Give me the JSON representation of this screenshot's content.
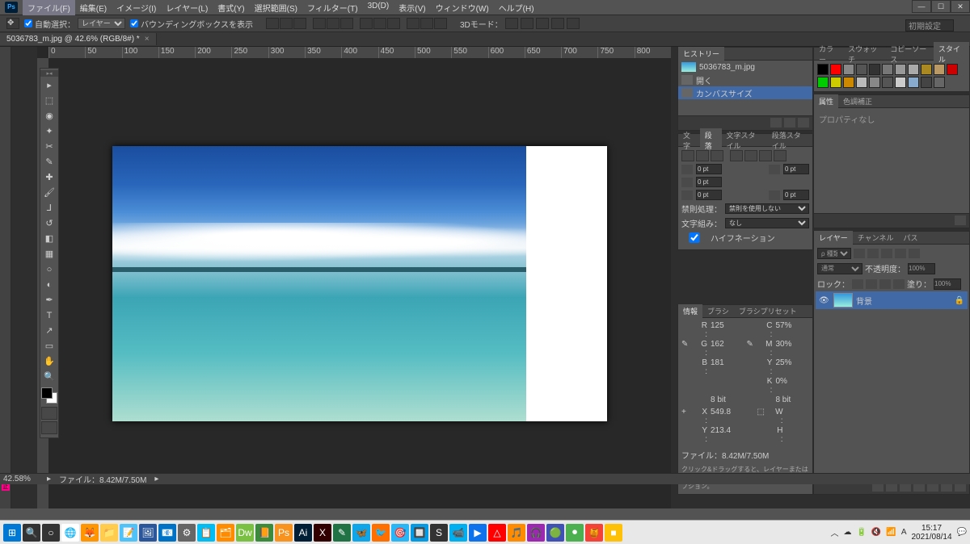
{
  "menu": [
    "ファイル(F)",
    "編集(E)",
    "イメージ(I)",
    "レイヤー(L)",
    "書式(Y)",
    "選択範囲(S)",
    "フィルター(T)",
    "3D(D)",
    "表示(V)",
    "ウィンドウ(W)",
    "ヘルプ(H)"
  ],
  "winbtns": {
    "min": "—",
    "max": "☐",
    "close": "✕"
  },
  "optbar": {
    "auto_select": "自動選択：",
    "auto_select_val": "レイヤー",
    "show_bbox": "バウンディングボックスを表示",
    "mode3d": "3Dモード："
  },
  "essentials_input": "初期設定",
  "doc_tab": "5036783_m.jpg @ 42.6% (RGB/8#) *",
  "zoom_status": "42.58%",
  "file_status": "ファイル：8.42M/7.50M",
  "ruler_marks": [
    "0",
    "50",
    "100",
    "150",
    "200",
    "250",
    "300",
    "350",
    "400",
    "450",
    "500",
    "550",
    "600",
    "650",
    "700",
    "750",
    "800"
  ],
  "history": {
    "tab": "ヒストリー",
    "thumb_label": "5036783_m.jpg",
    "items": [
      "開く",
      "カンバスサイズ"
    ]
  },
  "paragraph": {
    "tabs": [
      "文字",
      "段落",
      "文字スタイル",
      "段落スタイル"
    ],
    "indent_left": "0 pt",
    "indent_right": "0 pt",
    "indent_first": "0 pt",
    "space_before": "0 pt",
    "space_after": "0 pt",
    "kinsoku_label": "禁則処理：",
    "kinsoku_val": "禁則を使用しない",
    "mojikumi_label": "文字組み：",
    "mojikumi_val": "なし",
    "hyphen": "ハイフネーション"
  },
  "info": {
    "tabs": [
      "情報",
      "ブラシ",
      "ブラシプリセット"
    ],
    "R": "125",
    "G": "162",
    "B": "181",
    "bit1": "8 bit",
    "C": "57%",
    "M": "30%",
    "Y": "25%",
    "K": "0%",
    "bit2": "8 bit",
    "X": "549.8",
    "Y2": "213.4",
    "W": "",
    "H": "",
    "file": "ファイル：8.42M/7.50M",
    "hint": "クリック&ドラッグすると、レイヤーまたは選択範囲を移動します。Shift、Alt で追加オプション。"
  },
  "colors_panel": {
    "tabs": [
      "カラー",
      "スウォッチ",
      "コピーソース",
      "スタイル"
    ]
  },
  "swatch_colors": [
    "#000",
    "#f00",
    "#888",
    "#555",
    "#333",
    "#777",
    "#999",
    "#aaa",
    "#a82",
    "#b96",
    "#c00",
    "#0c0",
    "#cc0",
    "#c80",
    "#bbb",
    "#888",
    "#555",
    "#ccc",
    "#8ac",
    "#444",
    "#666"
  ],
  "props": {
    "tabs": [
      "属性",
      "色調補正"
    ],
    "body": "プロパティなし"
  },
  "layers": {
    "tabs": [
      "レイヤー",
      "チャンネル",
      "パス"
    ],
    "kind": "種類",
    "blend": "通常",
    "opacity_label": "不透明度：",
    "opacity": "100%",
    "lock_label": "ロック：",
    "fill_label": "塗り：",
    "fill": "100%",
    "layer_name": "背景"
  },
  "taskbar": {
    "icons": [
      "⊞",
      "🔍",
      "○",
      "🌐",
      "🦊",
      "📁",
      "📝",
      "🖼",
      "📧",
      "⚙",
      "📋",
      "🗂",
      "Dw",
      "📙",
      "Ps",
      "Ai",
      "X",
      "✎",
      "🦋",
      "🐦",
      "🎯",
      "🔲",
      "S",
      "📹",
      "▶",
      "△",
      "🎵",
      "🎧",
      "🟢",
      "⏺",
      "🍯",
      "■"
    ],
    "time": "15:17",
    "date": "2021/08/14"
  }
}
